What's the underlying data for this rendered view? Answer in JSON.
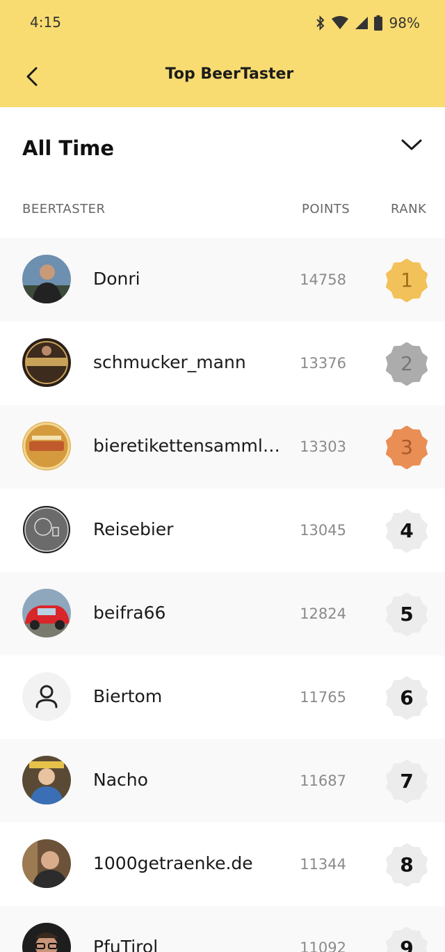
{
  "status": {
    "time": "4:15",
    "battery": "98%"
  },
  "header": {
    "title": "Top BeerTaster"
  },
  "filter": {
    "label": "All Time"
  },
  "columns": {
    "user": "BEERTASTER",
    "points": "POINTS",
    "rank": "RANK"
  },
  "colors": {
    "header_bg": "#f9dc71",
    "gold": "#f3c15a",
    "silver": "#acacac",
    "bronze": "#e98e55",
    "default_badge": "#ececec"
  },
  "rows": [
    {
      "name": "Donri",
      "points": "14758",
      "rank": "1",
      "avatar": "photo-man"
    },
    {
      "name": "schmucker_mann",
      "points": "13376",
      "rank": "2",
      "avatar": "brewery-logo"
    },
    {
      "name": "bieretikettensammler...",
      "points": "13303",
      "rank": "3",
      "avatar": "beer-label"
    },
    {
      "name": "Reisebier",
      "points": "13045",
      "rank": "4",
      "avatar": "reisebier-logo"
    },
    {
      "name": "beifra66",
      "points": "12824",
      "rank": "5",
      "avatar": "red-car"
    },
    {
      "name": "Biertom",
      "points": "11765",
      "rank": "6",
      "avatar": "default-person-icon"
    },
    {
      "name": "Nacho",
      "points": "11687",
      "rank": "7",
      "avatar": "photo-child"
    },
    {
      "name": "1000getraenke.de",
      "points": "11344",
      "rank": "8",
      "avatar": "photo-man-2"
    },
    {
      "name": "PfuTirol",
      "points": "11092",
      "rank": "9",
      "avatar": "photo-glasses"
    }
  ]
}
